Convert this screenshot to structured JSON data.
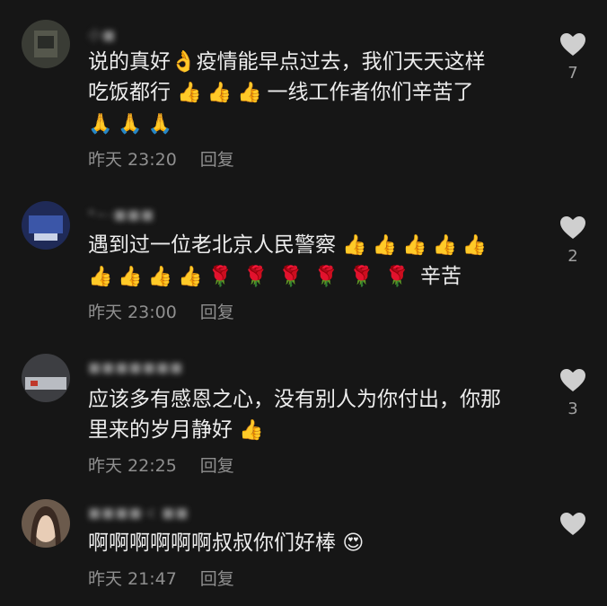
{
  "comments": [
    {
      "username": "小■",
      "text_line1": "说的真好",
      "emoji_ok": "👌",
      "text_line1b": "疫情能早点过去，我们天天这样",
      "text_line2": "吃饭都行",
      "emoji_thumbs_a": "👍👍👍",
      "text_line2b": "一线工作者你们辛苦了",
      "emoji_pray": "🙏🙏🙏",
      "time": "昨天 23:20",
      "reply_label": "回复",
      "likes": "7"
    },
    {
      "username": "*~-■■■",
      "text_line1": "遇到过一位老北京人民警察",
      "emoji_thumbs_a": "👍👍👍👍👍",
      "emoji_thumbs_b": "👍👍👍👍",
      "emoji_roses": "🌹🌹🌹🌹🌹🌹",
      "text_line2b": "辛苦",
      "time": "昨天 23:00",
      "reply_label": "回复",
      "likes": "2"
    },
    {
      "username": "■■■■■■■",
      "text_line1": "应该多有感恩之心，没有别人为你付出，你那",
      "text_line2": "里来的岁月静好",
      "emoji_thumbs_a": "👍",
      "time": "昨天 22:25",
      "reply_label": "回复",
      "likes": "3"
    },
    {
      "username": "■■■■-c ■■",
      "text_line1": "啊啊啊啊啊啊叔叔你们好棒",
      "emoji_heart_eyes": "😍",
      "time": "昨天 21:47",
      "reply_label": "回复",
      "likes": ""
    }
  ],
  "colors": {
    "background": "#161616",
    "text": "#ececec",
    "meta": "#8f8f8f",
    "heart": "#d0d0d0"
  },
  "icons": [
    "heart-icon",
    "avatar"
  ]
}
